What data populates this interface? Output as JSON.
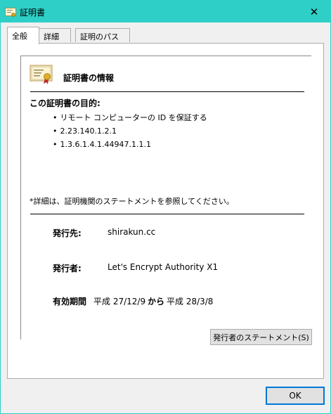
{
  "window": {
    "title": "証明書",
    "close_glyph": "✕",
    "accent": "#2ecfc7"
  },
  "tabs": [
    {
      "label": "全般",
      "active": true
    },
    {
      "label": "詳細",
      "active": false
    },
    {
      "label": "証明のパス",
      "active": false
    }
  ],
  "general": {
    "heading": "証明書の情報",
    "purpose_label": "この証明書の目的:",
    "purposes": [
      "リモート コンピューターの ID を保証する",
      "2.23.140.1.2.1",
      "1.3.6.1.4.1.44947.1.1.1"
    ],
    "note": "*詳細は、証明機関のステートメントを参照してください。",
    "issued_to_label": "発行先:",
    "issued_to": "shirakun.cc",
    "issued_by_label": "発行者:",
    "issued_by": "Let's Encrypt Authority X1",
    "validity_label": "有効期間",
    "valid_from": "平成 27/12/9",
    "validity_sep": "から",
    "valid_to": "平成 28/3/8"
  },
  "buttons": {
    "issuer_statement": "発行者のステートメント(S)",
    "ok": "OK"
  }
}
